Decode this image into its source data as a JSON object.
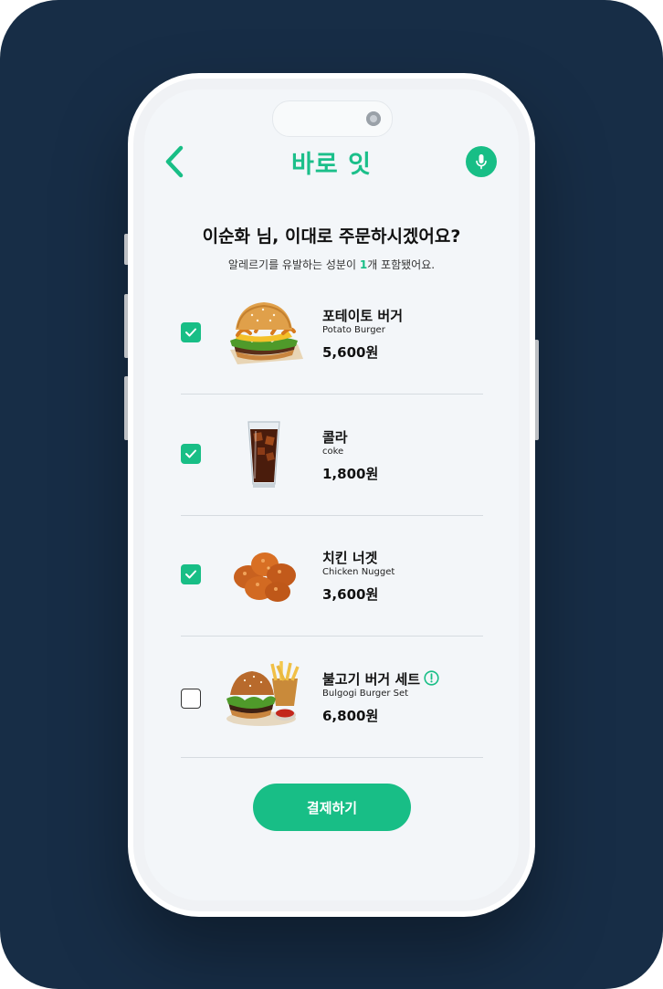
{
  "app": {
    "brand": "바로 잇"
  },
  "header": {
    "back_icon": "chevron-left-icon",
    "mic_icon": "microphone-icon"
  },
  "order": {
    "title": "이순화 님, 이대로 주문하시겠어요?",
    "allergy_prefix": "알레르기를 유발하는 성분이 ",
    "allergy_count": "1",
    "allergy_suffix": "개 포함됐어요."
  },
  "items": [
    {
      "name": "포테이토 버거",
      "name_en": "Potato Burger",
      "price": "5,600원",
      "checked": true,
      "allergy": false,
      "image": "burger-image"
    },
    {
      "name": "콜라",
      "name_en": "coke",
      "price": "1,800원",
      "checked": true,
      "allergy": false,
      "image": "cola-image"
    },
    {
      "name": "치킨 너겟",
      "name_en": "Chicken Nugget",
      "price": "3,600원",
      "checked": true,
      "allergy": false,
      "image": "nugget-image"
    },
    {
      "name": "불고기 버거 세트",
      "name_en": "Bulgogi Burger Set",
      "price": "6,800원",
      "checked": false,
      "allergy": true,
      "image": "burger-set-image"
    }
  ],
  "actions": {
    "pay_label": "결제하기"
  },
  "colors": {
    "accent": "#18be86",
    "background": "#172d46",
    "screen": "#f3f6f9"
  }
}
